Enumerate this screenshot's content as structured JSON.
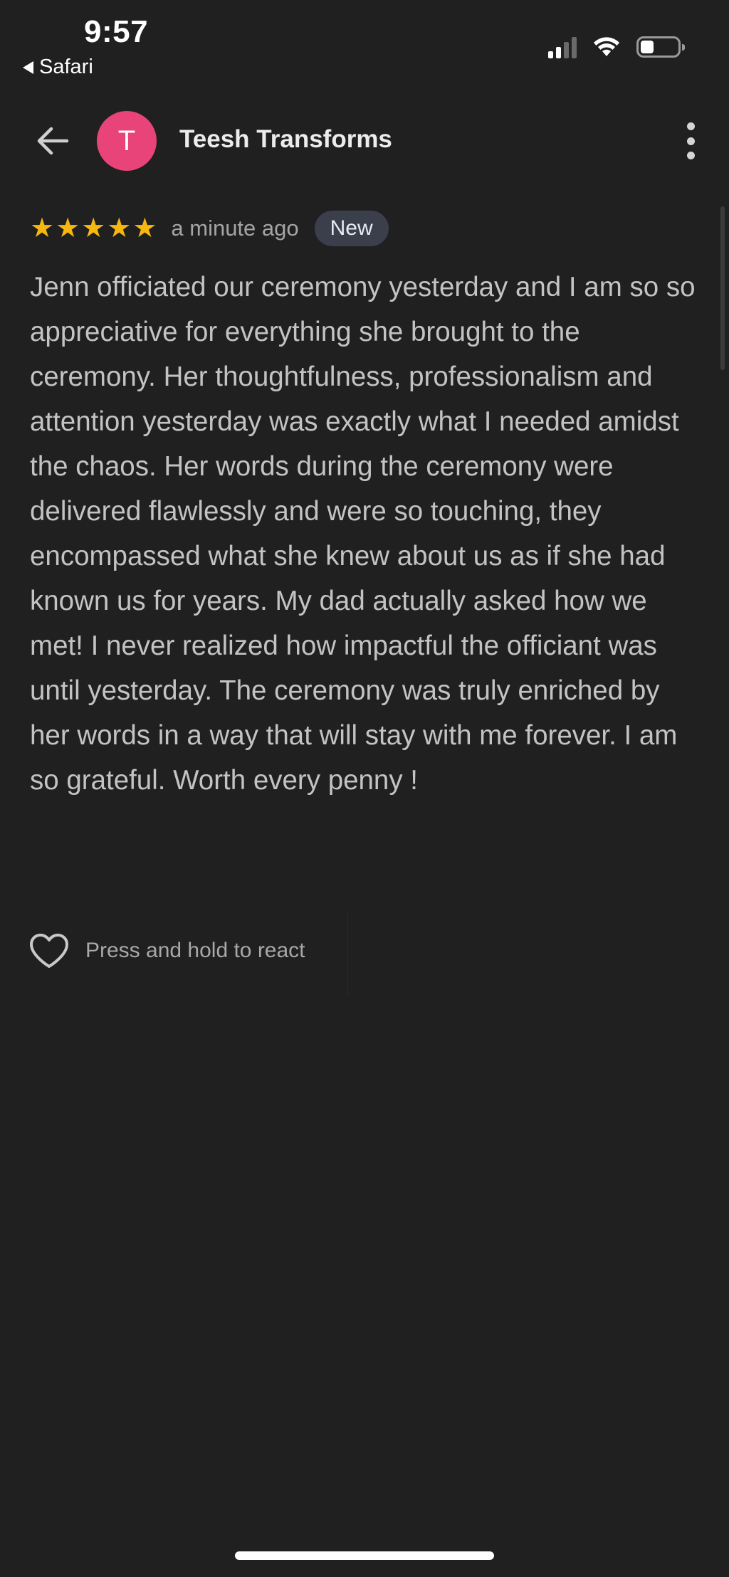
{
  "status_bar": {
    "time": "9:57",
    "back_app_label": "Safari"
  },
  "header": {
    "avatar_letter": "T",
    "avatar_color": "#e8447a",
    "business_name": "Teesh Transforms"
  },
  "review": {
    "rating": 5,
    "rating_max": 5,
    "time_ago": "a minute ago",
    "badge": "New",
    "text": "Jenn officiated our ceremony yesterday and I am so so appreciative for everything she brought to the ceremony. Her thoughtfulness, professionalism and attention yesterday was exactly what I needed amidst the chaos. Her words during the ceremony were delivered flawlessly and were so touching, they encompassed what she knew about us as if she had known us for years. My dad actually asked how we met! I never realized how impactful the officiant was until yesterday. The ceremony was truly enriched by her words in a way that will stay with me forever. I am so grateful. Worth every penny !"
  },
  "reaction": {
    "label": "Press and hold to react"
  },
  "colors": {
    "background": "#202020",
    "star": "#f6b711",
    "badge_bg": "#3b3f4c"
  },
  "icons": [
    "back-arrow-icon",
    "more-vert-icon",
    "star-icon",
    "heart-outline-icon",
    "signal-icon",
    "wifi-icon",
    "battery-icon"
  ]
}
